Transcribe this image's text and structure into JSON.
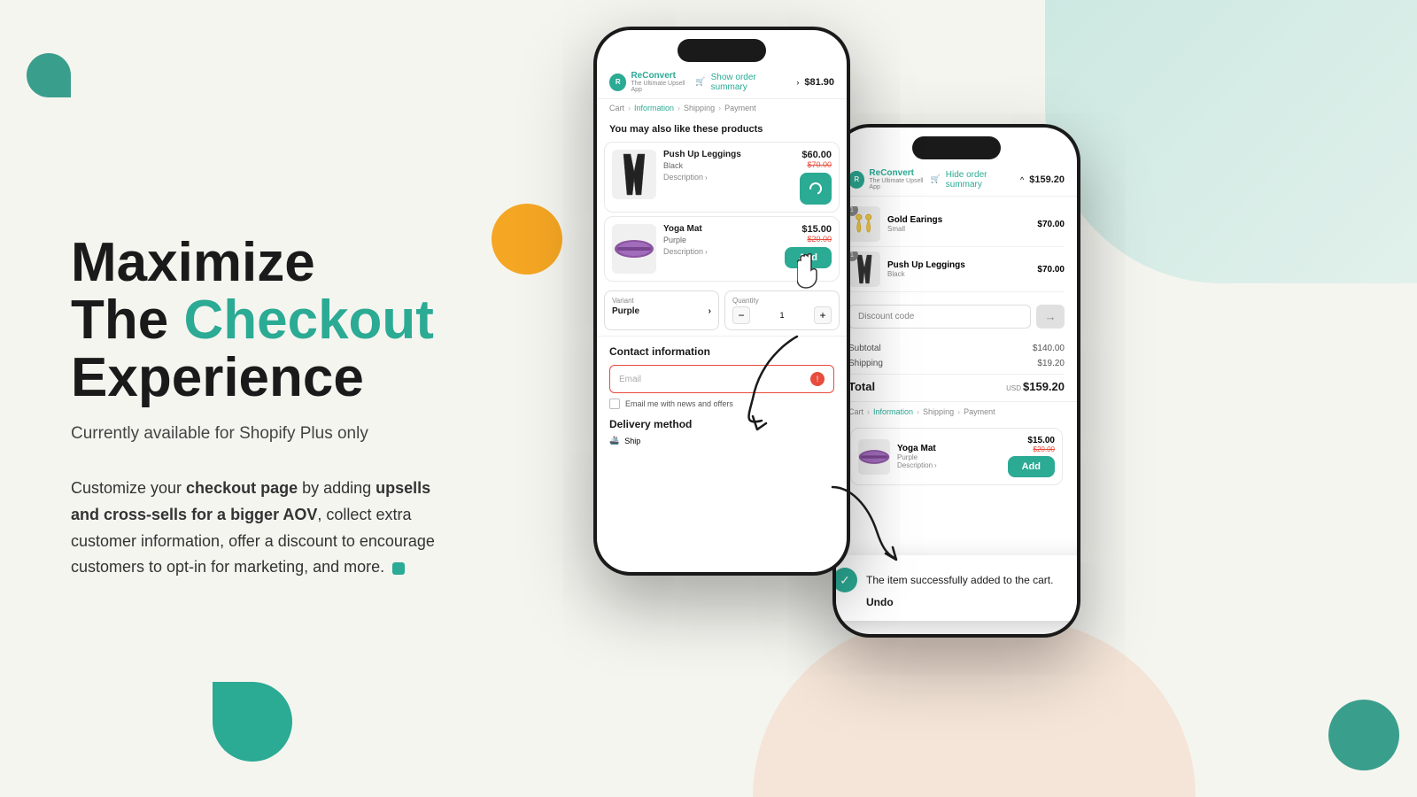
{
  "background": {
    "colors": {
      "teal": "#2baa94",
      "orange": "#f5a623",
      "peach": "#f5d6c0"
    }
  },
  "left": {
    "headline_line1": "Maximize",
    "headline_line2_plain": "The ",
    "headline_line2_teal": "Checkout",
    "headline_line3": "Experience",
    "subtitle": "Currently available for Shopify Plus only",
    "body_text_1": "Customize your ",
    "body_bold_1": "checkout page",
    "body_text_2": " by adding ",
    "body_bold_2": "upsells and cross-sells for a bigger AOV",
    "body_text_3": ", collect extra customer information, offer a discount to encourage customers to opt-in for marketing, and more."
  },
  "phone_main": {
    "logo": "ReConvert",
    "logo_sub": "The Ultimate Upsell App",
    "order_summary_label": "Show order summary",
    "order_price": "$81.90",
    "breadcrumb": [
      "Cart",
      "Information",
      "Shipping",
      "Payment"
    ],
    "breadcrumb_active": "Information",
    "you_may_also_like": "You may also like these products",
    "products": [
      {
        "name": "Push Up Leggings",
        "variant": "Black",
        "description": "Description",
        "price_current": "$60.00",
        "price_original": "$70.00",
        "button_state": "loading"
      },
      {
        "name": "Yoga Mat",
        "variant": "Purple",
        "description": "Description",
        "price_current": "$15.00",
        "price_original": "$20.00",
        "button_state": "add",
        "button_label": "Add"
      }
    ],
    "variant_label": "Variant",
    "variant_value": "Purple",
    "quantity_label": "Quantity",
    "quantity_value": "1",
    "contact_section": {
      "title": "Contact information",
      "email_placeholder": "Email",
      "email_error": true,
      "newsletter_label": "Email me with news and offers"
    },
    "delivery_section": {
      "title": "Delivery method",
      "option": "Ship"
    }
  },
  "phone_right": {
    "logo": "ReConvert",
    "logo_sub": "The Ultimate Upsell App",
    "order_summary_label": "Hide order summary",
    "order_price": "$159.20",
    "breadcrumb": [
      "Cart",
      "Information",
      "Shipping",
      "Payment"
    ],
    "breadcrumb_active": "Information",
    "order_items": [
      {
        "name": "Gold Earings",
        "variant": "Small",
        "price": "$70.00",
        "quantity": 1
      },
      {
        "name": "Push Up Leggings",
        "variant": "Black",
        "price": "$70.00",
        "quantity": 1
      }
    ],
    "discount_placeholder": "Discount code",
    "subtotal_label": "Subtotal",
    "subtotal_value": "$140.00",
    "shipping_label": "Shipping",
    "shipping_value": "$19.20",
    "total_label": "Total",
    "total_currency": "USD",
    "total_value": "$159.20",
    "toast": {
      "message": "The item successfully added to the cart.",
      "undo_label": "Undo"
    },
    "bottom_product": {
      "name": "Yoga Mat",
      "variant": "Purple",
      "description": "Description",
      "price_current": "$15.00",
      "price_original": "$20.00",
      "button_label": "Add"
    }
  },
  "icons": {
    "cart": "🛒",
    "chevron_down": "›",
    "check": "✓",
    "close": "✕",
    "arrow_right": "→",
    "spinner": "◌",
    "loading": "..."
  }
}
